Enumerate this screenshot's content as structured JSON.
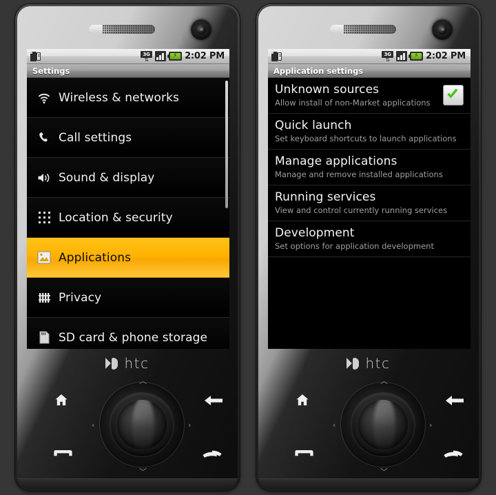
{
  "background_color": "#363636",
  "accent_color": "#ffb300",
  "devices": [
    {
      "id": "left",
      "brand": "htc",
      "status_bar": {
        "time": "2:02 PM",
        "icons": [
          "sd-card-warning-icon",
          "3g-data-icon",
          "signal-bars-icon",
          "battery-charging-icon"
        ],
        "network_label": "3G",
        "battery_state": "charging"
      },
      "title": "Settings",
      "list": [
        {
          "icon": "wifi-icon",
          "label": "Wireless & networks",
          "selected": false
        },
        {
          "icon": "phone-icon",
          "label": "Call settings",
          "selected": false
        },
        {
          "icon": "speaker-icon",
          "label": "Sound & display",
          "selected": false
        },
        {
          "icon": "location-icon",
          "label": "Location & security",
          "selected": false
        },
        {
          "icon": "apps-icon",
          "label": "Applications",
          "selected": true
        },
        {
          "icon": "privacy-icon",
          "label": "Privacy",
          "selected": false
        },
        {
          "icon": "sdcard-icon",
          "label": "SD card & phone storage",
          "selected": false
        }
      ],
      "scrollbar": {
        "visible": true,
        "top_pct": 0,
        "height_pct": 48
      },
      "hardware_keys": [
        "home-key",
        "back-key",
        "call-key",
        "end-call-key",
        "trackball"
      ]
    },
    {
      "id": "right",
      "brand": "htc",
      "status_bar": {
        "time": "2:02 PM",
        "icons": [
          "sd-card-warning-icon",
          "3g-data-icon",
          "signal-bars-icon",
          "battery-charging-icon"
        ],
        "network_label": "3G",
        "battery_state": "charging"
      },
      "title": "Application settings",
      "list": [
        {
          "label": "Unknown sources",
          "summary": "Allow install of non-Market applications",
          "checkbox": true,
          "checked": true
        },
        {
          "label": "Quick launch",
          "summary": "Set keyboard shortcuts to launch applications",
          "checkbox": false
        },
        {
          "label": "Manage applications",
          "summary": "Manage and remove installed applications",
          "checkbox": false
        },
        {
          "label": "Running services",
          "summary": "View and control currently running services",
          "checkbox": false
        },
        {
          "label": "Development",
          "summary": "Set options for application development",
          "checkbox": false
        }
      ],
      "scrollbar": {
        "visible": false
      },
      "hardware_keys": [
        "home-key",
        "back-key",
        "call-key",
        "end-call-key",
        "trackball"
      ]
    }
  ]
}
